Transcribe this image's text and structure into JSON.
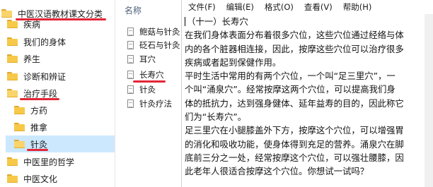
{
  "tree": {
    "root": "中医汉语教材课文分类",
    "items": [
      {
        "label": "疾病"
      },
      {
        "label": "我们的身体"
      },
      {
        "label": "养生"
      },
      {
        "label": "诊断和辨证"
      },
      {
        "label": "治疗手段"
      },
      {
        "label": "方药"
      },
      {
        "label": "推拿"
      },
      {
        "label": "针灸"
      },
      {
        "label": "中医里的哲学"
      },
      {
        "label": "中医文化"
      }
    ]
  },
  "files": {
    "header": "名称",
    "items": [
      {
        "label": "鲍菇与针灸"
      },
      {
        "label": "砭石与针灸"
      },
      {
        "label": "耳穴"
      },
      {
        "label": "长寿穴"
      },
      {
        "label": "针灸"
      },
      {
        "label": "针灸疗法"
      }
    ]
  },
  "notepad": {
    "menu": [
      "文件(F)",
      "编辑(E)",
      "格式(O)",
      "查看(V)",
      "帮助(H)"
    ],
    "lines": [
      "（十一）长寿穴",
      "在我们身体表面分布着很多穴位，这些穴位通过经络与体",
      "内的各个脏器相连接，因此，按摩这些穴位可以治疗很多",
      "疾病或者起到保健作用。",
      "平时生活中常用的有两个穴位，一个叫“足三里穴”，一",
      "个叫“涌泉穴”。经常按摩这两个穴位，可以提高我们身",
      "体的抵抗力，达到强身健体、延年益寿的目的，因此称它",
      "们为“长寿穴”。",
      "足三里穴在小腿膝盖外下方，按摩这个穴位，可以增强胃",
      "的消化和吸收功能，使身体得到充足的营养。涌泉穴在脚",
      "底前三分之一处，经常按摩这个穴位，可以强壮腰膝，因",
      "此老年人很适合按摩这个穴位。你想试一试吗？"
    ]
  },
  "colors": {
    "selection": "#cce8ff",
    "annotation": "#e32636",
    "folder": "#f7c948"
  }
}
